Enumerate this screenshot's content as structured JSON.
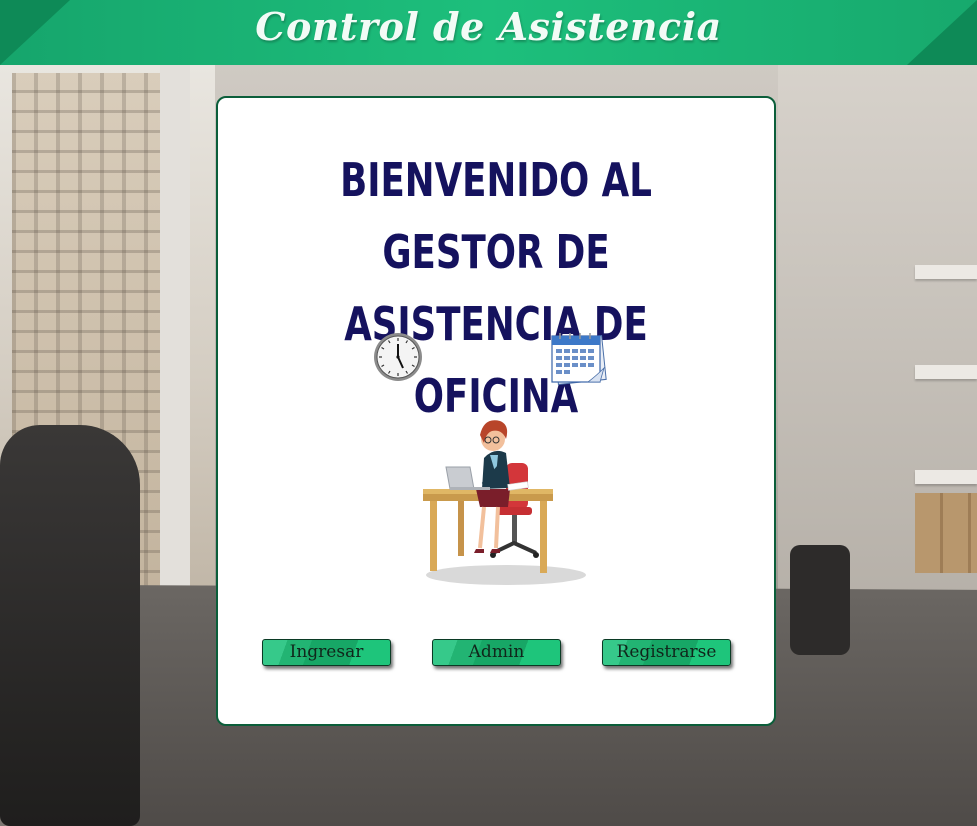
{
  "header": {
    "title": "Control de Asistencia"
  },
  "main": {
    "welcome_line1": "BIENVENIDO AL GESTOR DE",
    "welcome_line2": "ASISTENCIA DE OFICINA",
    "icons": [
      "clock-icon",
      "calendar-icon",
      "office-worker-illustration"
    ]
  },
  "buttons": {
    "ingresar": "Ingresar",
    "admin": "Admin",
    "registrarse": "Registrarse"
  },
  "colors": {
    "header_green": "#1dbf7c",
    "title_navy": "#15125e",
    "button_green": "#1ec57b",
    "card_border": "#0b5e3a"
  }
}
